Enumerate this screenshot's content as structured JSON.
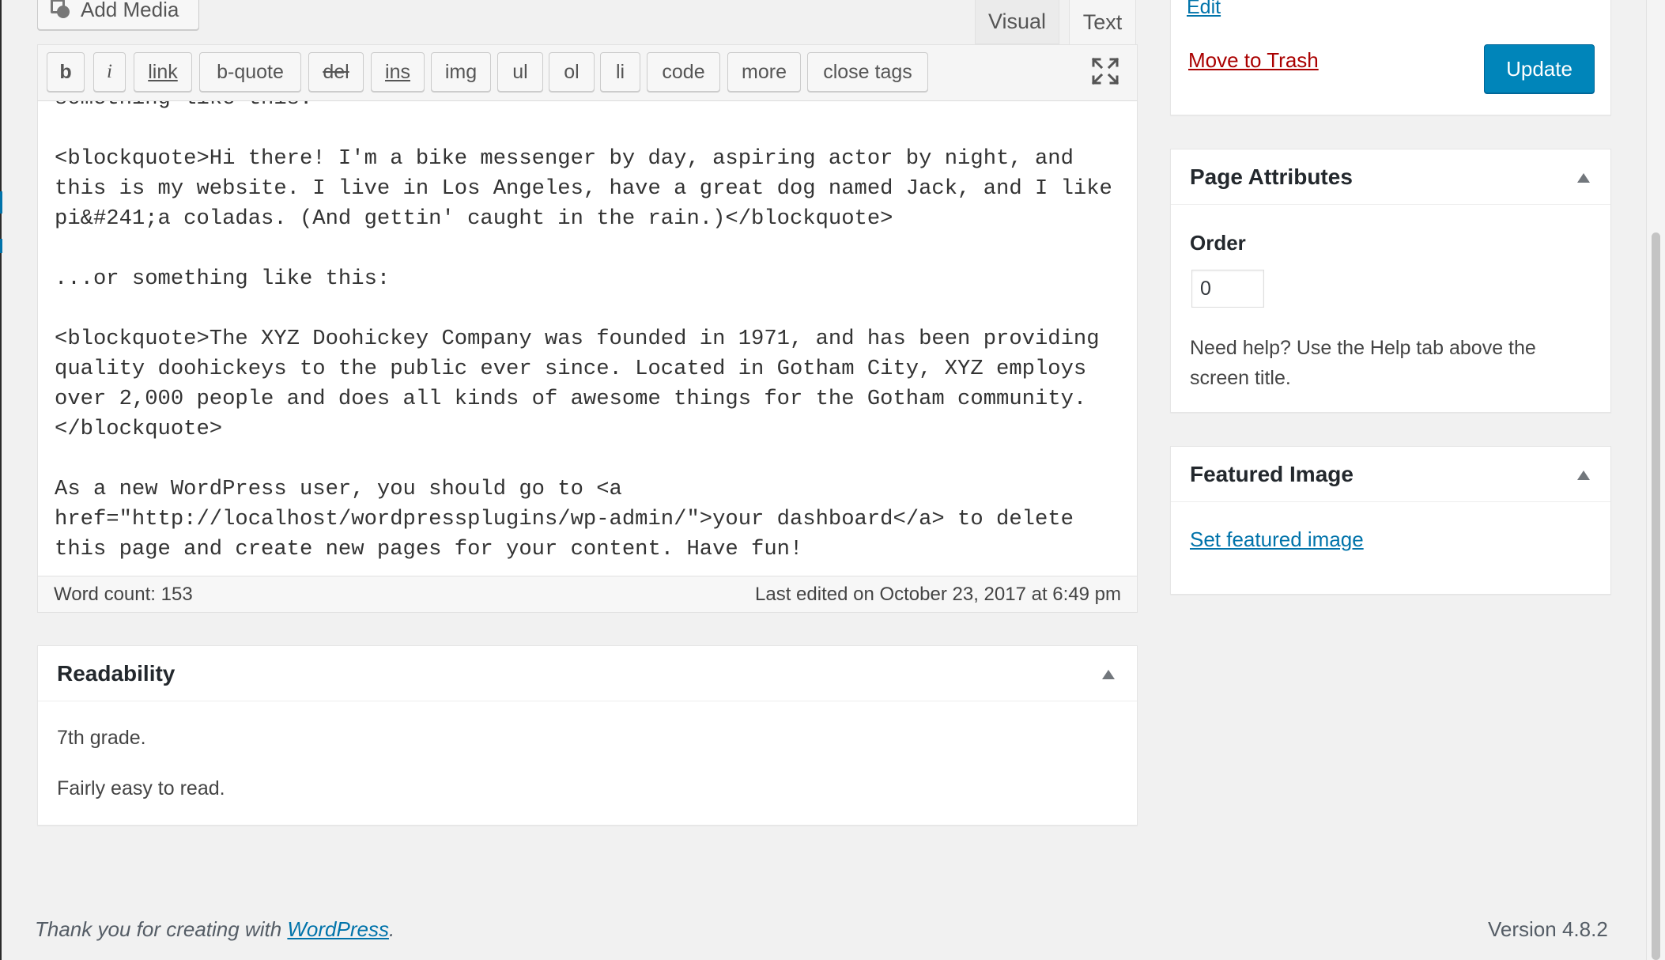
{
  "editor": {
    "add_media_label": "Add Media",
    "tabs": {
      "visual": "Visual",
      "text": "Text"
    },
    "quicktags": {
      "b": "b",
      "i": "i",
      "link": "link",
      "b_quote": "b-quote",
      "del": "del",
      "ins": "ins",
      "img": "img",
      "ul": "ul",
      "ol": "ol",
      "li": "li",
      "code": "code",
      "more": "more",
      "close_tags": "close tags"
    },
    "fullscreen_icon": "distraction-free-icon",
    "content": "something like this:\n\n<blockquote>Hi there! I'm a bike messenger by day, aspiring actor by night, and this is my website. I live in Los Angeles, have a great dog named Jack, and I like pi&#241;a coladas. (And gettin' caught in the rain.)</blockquote>\n\n...or something like this:\n\n<blockquote>The XYZ Doohickey Company was founded in 1971, and has been providing quality doohickeys to the public ever since. Located in Gotham City, XYZ employs over 2,000 people and does all kinds of awesome things for the Gotham community.</blockquote>\n\nAs a new WordPress user, you should go to <a href=\"http://localhost/wordpressplugins/wp-admin/\">your dashboard</a> to delete this page and create new pages for your content. Have fun!",
    "word_count": "Word count: 153",
    "last_edited": "Last edited on October 23, 2017 at 6:49 pm"
  },
  "readability": {
    "title": "Readability",
    "grade": "7th grade.",
    "summary": "Fairly easy to read."
  },
  "publish": {
    "edit_link": "Edit",
    "trash_link": "Move to Trash",
    "update_label": "Update"
  },
  "page_attributes": {
    "title": "Page Attributes",
    "order_label": "Order",
    "order_value": "0",
    "help_text": "Need help? Use the Help tab above the screen title."
  },
  "featured_image": {
    "title": "Featured Image",
    "set_link": "Set featured image"
  },
  "footer": {
    "thanks_prefix": "Thank you for creating with ",
    "wordpress_link": "WordPress",
    "thanks_suffix": ".",
    "version": "Version 4.8.2"
  },
  "colors": {
    "accent": "#0073aa",
    "primary_button": "#0085ba",
    "trash": "#a00000",
    "background": "#f1f1f1"
  }
}
